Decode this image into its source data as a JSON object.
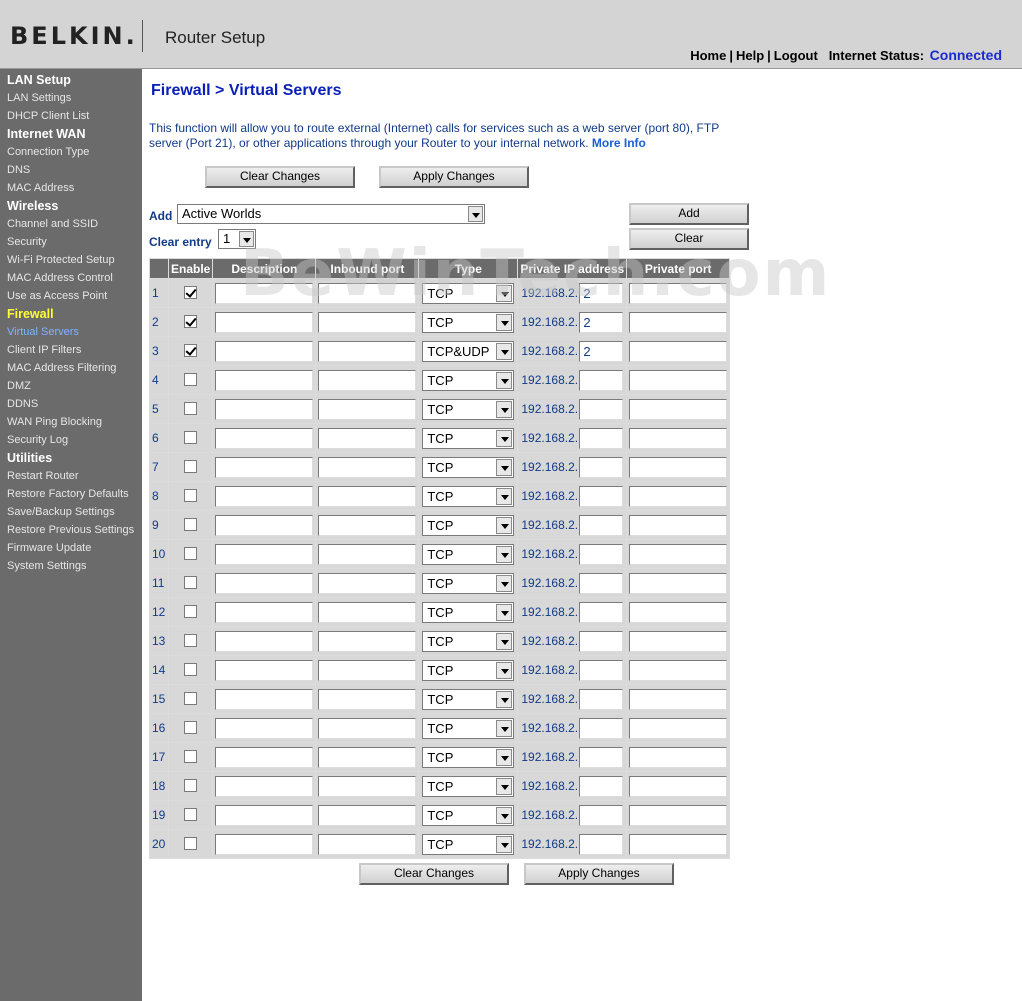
{
  "header": {
    "logo": "BELKIN.",
    "app_title": "Router Setup",
    "links": {
      "home": "Home",
      "help": "Help",
      "logout": "Logout"
    },
    "status_label": "Internet Status:",
    "status_value": "Connected"
  },
  "sidebar": [
    {
      "type": "section",
      "label": "LAN Setup"
    },
    {
      "type": "item",
      "label": "LAN Settings"
    },
    {
      "type": "item",
      "label": "DHCP Client List"
    },
    {
      "type": "section",
      "label": "Internet WAN"
    },
    {
      "type": "item",
      "label": "Connection Type"
    },
    {
      "type": "item",
      "label": "DNS"
    },
    {
      "type": "item",
      "label": "MAC Address"
    },
    {
      "type": "section",
      "label": "Wireless"
    },
    {
      "type": "item",
      "label": "Channel and SSID"
    },
    {
      "type": "item",
      "label": "Security"
    },
    {
      "type": "item",
      "label": "Wi-Fi Protected Setup"
    },
    {
      "type": "item",
      "label": "MAC Address Control"
    },
    {
      "type": "item",
      "label": "Use as Access Point"
    },
    {
      "type": "section",
      "label": "Firewall",
      "active": true
    },
    {
      "type": "item",
      "label": "Virtual Servers",
      "active": true
    },
    {
      "type": "item",
      "label": "Client IP Filters"
    },
    {
      "type": "item",
      "label": "MAC Address Filtering"
    },
    {
      "type": "item",
      "label": "DMZ"
    },
    {
      "type": "item",
      "label": "DDNS"
    },
    {
      "type": "item",
      "label": "WAN Ping Blocking"
    },
    {
      "type": "item",
      "label": "Security Log"
    },
    {
      "type": "section",
      "label": "Utilities"
    },
    {
      "type": "item",
      "label": "Restart Router"
    },
    {
      "type": "item",
      "label": "Restore Factory Defaults"
    },
    {
      "type": "item",
      "label": "Save/Backup Settings"
    },
    {
      "type": "item",
      "label": "Restore Previous Settings"
    },
    {
      "type": "item",
      "label": "Firmware Update"
    },
    {
      "type": "item",
      "label": "System Settings"
    }
  ],
  "main": {
    "title": "Firewall > Virtual Servers",
    "description": "This function will allow you to route external (Internet) calls for services such as a web server (port 80), FTP server (Port 21), or other applications through your Router to your internal network.",
    "more_info": "More Info",
    "clear_changes_label": "Clear Changes",
    "apply_changes_label": "Apply Changes",
    "add_label": "Add",
    "add_select_value": "Active Worlds",
    "add_button_label": "Add",
    "clear_entry_label": "Clear entry",
    "clear_entry_value": "1",
    "clear_button_label": "Clear"
  },
  "table": {
    "headers": [
      "Enable",
      "Description",
      "Inbound port",
      "Type",
      "Private IP address",
      "Private port"
    ],
    "ip_prefix": "192.168.2.",
    "rows": [
      {
        "num": "1",
        "enabled": true,
        "type": "TCP",
        "ip_last": "2"
      },
      {
        "num": "2",
        "enabled": true,
        "type": "TCP",
        "ip_last": "2"
      },
      {
        "num": "3",
        "enabled": true,
        "type": "TCP&UDP",
        "ip_last": "2"
      },
      {
        "num": "4",
        "enabled": false,
        "type": "TCP",
        "ip_last": ""
      },
      {
        "num": "5",
        "enabled": false,
        "type": "TCP",
        "ip_last": ""
      },
      {
        "num": "6",
        "enabled": false,
        "type": "TCP",
        "ip_last": ""
      },
      {
        "num": "7",
        "enabled": false,
        "type": "TCP",
        "ip_last": ""
      },
      {
        "num": "8",
        "enabled": false,
        "type": "TCP",
        "ip_last": ""
      },
      {
        "num": "9",
        "enabled": false,
        "type": "TCP",
        "ip_last": ""
      },
      {
        "num": "10",
        "enabled": false,
        "type": "TCP",
        "ip_last": ""
      },
      {
        "num": "11",
        "enabled": false,
        "type": "TCP",
        "ip_last": ""
      },
      {
        "num": "12",
        "enabled": false,
        "type": "TCP",
        "ip_last": ""
      },
      {
        "num": "13",
        "enabled": false,
        "type": "TCP",
        "ip_last": ""
      },
      {
        "num": "14",
        "enabled": false,
        "type": "TCP",
        "ip_last": ""
      },
      {
        "num": "15",
        "enabled": false,
        "type": "TCP",
        "ip_last": ""
      },
      {
        "num": "16",
        "enabled": false,
        "type": "TCP",
        "ip_last": ""
      },
      {
        "num": "17",
        "enabled": false,
        "type": "TCP",
        "ip_last": ""
      },
      {
        "num": "18",
        "enabled": false,
        "type": "TCP",
        "ip_last": ""
      },
      {
        "num": "19",
        "enabled": false,
        "type": "TCP",
        "ip_last": ""
      },
      {
        "num": "20",
        "enabled": false,
        "type": "TCP",
        "ip_last": ""
      }
    ]
  },
  "watermark": "BeWinTech.com"
}
